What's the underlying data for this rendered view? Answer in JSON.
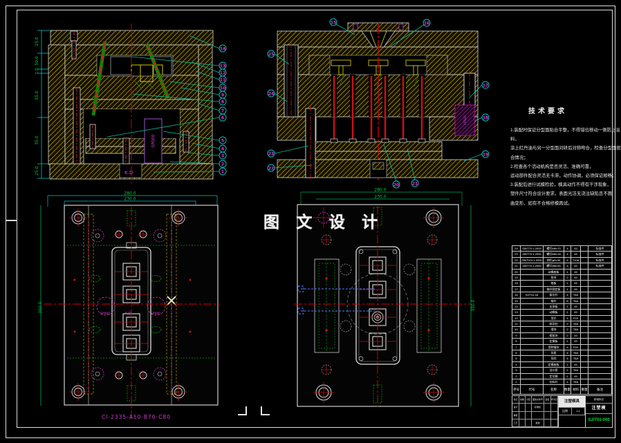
{
  "drawing": {
    "watermark": "图 文 设 计",
    "part_code": "CI-2335-A50-B70-C80"
  },
  "tech": {
    "title": "技术要求",
    "lines": [
      "1.装配时保证分型面贴合平整，不得错位移动一侧防止溢料，",
      "涂上红丹油与另一分型面对研后对称吻合，检查分型面密合情况；",
      "2.检查各个活动机构是否灵活、准确可靠，",
      "运动部件配合灵活无卡滞，动作协调，必须保证顺畅；",
      "3.装配后进行试模检验，模具动作不得有干涉现象，",
      "塑件尺寸符合设计要求，表面光洁无浇注缺陷且不翘",
      "曲变形、如有不合格修模再试。"
    ]
  },
  "views": {
    "section_left": {
      "dims": [
        "25.0",
        "50.0",
        "1.0",
        "55.0",
        "35.0",
        "25.0"
      ],
      "balloons": [
        "14",
        "13",
        "12",
        "11",
        "10",
        "9",
        "8",
        "7",
        "6",
        "5",
        "4",
        "3",
        "2",
        "1"
      ],
      "insert_label": "SP000",
      "gate_label": "K.D"
    },
    "section_right": {
      "balloons_top": [
        "15",
        "16"
      ],
      "balloons_left": [
        "25",
        "24",
        "23",
        "22"
      ],
      "balloons_right": [
        "17",
        "18",
        "19"
      ],
      "balloons_bottom": [
        "20",
        "21"
      ],
      "side_label": "SP000"
    },
    "plan_left": {
      "dim_outer": "280.0",
      "dim_inner": "230.0",
      "dim_height": "350.0",
      "sp_left": "SP000",
      "center_label": "K.D",
      "sp_right": "SP000"
    },
    "plan_right": {
      "dim_outer": "280.0",
      "dim_inner": "230.0",
      "dim_height": "350.0"
    }
  },
  "bom": {
    "headers": {
      "n": "序号",
      "code": "代号",
      "name": "名称",
      "qty": "数量",
      "mat": "材料",
      "wt": "重量",
      "rem": "备注"
    },
    "rows": [
      {
        "n": "24",
        "code": "GB/T70.1-2000",
        "name": "螺钉M8×70",
        "qty": "4",
        "mat": "45",
        "wt": "",
        "rem": "标准件"
      },
      {
        "n": "23",
        "code": "GB/T70.1-2000",
        "name": "螺钉M6×16",
        "qty": "4",
        "mat": "45",
        "wt": "",
        "rem": "标准件"
      },
      {
        "n": "22",
        "code": "GB/T119.1-2000",
        "name": "销钉φ6×30",
        "qty": "4",
        "mat": "T10A",
        "wt": "",
        "rem": "标准件"
      },
      {
        "n": "21",
        "code": "GB/T70.1-2000",
        "name": "螺钉M8×90",
        "qty": "4",
        "mat": "45",
        "wt": "",
        "rem": "标准件"
      },
      {
        "n": "20",
        "code": "",
        "name": "动模座板",
        "qty": "1",
        "mat": "45",
        "wt": "",
        "rem": ""
      },
      {
        "n": "19",
        "code": "",
        "name": "垫块",
        "qty": "2",
        "mat": "45",
        "wt": "",
        "rem": ""
      },
      {
        "n": "18",
        "code": "",
        "name": "推板",
        "qty": "1",
        "mat": "45",
        "wt": "",
        "rem": ""
      },
      {
        "n": "17",
        "code": "",
        "name": "推杆固定板",
        "qty": "1",
        "mat": "45",
        "wt": "",
        "rem": ""
      },
      {
        "n": "16",
        "code": "SJ/T01-16",
        "name": "复位杆",
        "qty": "4",
        "mat": "T8A",
        "wt": "",
        "rem": ""
      },
      {
        "n": "15",
        "code": "",
        "name": "推杆",
        "qty": "8",
        "mat": "T8A",
        "wt": "",
        "rem": ""
      },
      {
        "n": "14",
        "code": "",
        "name": "支承板",
        "qty": "1",
        "mat": "45",
        "wt": "",
        "rem": ""
      },
      {
        "n": "13",
        "code": "",
        "name": "动模板",
        "qty": "1",
        "mat": "45",
        "wt": "",
        "rem": ""
      },
      {
        "n": "12",
        "code": "",
        "name": "型芯",
        "qty": "4",
        "mat": "P20",
        "wt": "",
        "rem": ""
      },
      {
        "n": "11",
        "code": "",
        "name": "斜导柱",
        "qty": "2",
        "mat": "T8A",
        "wt": "",
        "rem": ""
      },
      {
        "n": "10",
        "code": "",
        "name": "滑块",
        "qty": "2",
        "mat": "T8A",
        "wt": "",
        "rem": ""
      },
      {
        "n": "9",
        "code": "",
        "name": "楔紧块",
        "qty": "2",
        "mat": "45",
        "wt": "",
        "rem": ""
      },
      {
        "n": "8",
        "code": "",
        "name": "定模板",
        "qty": "1",
        "mat": "45",
        "wt": "",
        "rem": ""
      },
      {
        "n": "7",
        "code": "",
        "name": "型腔镶块",
        "qty": "4",
        "mat": "P20",
        "wt": "",
        "rem": ""
      },
      {
        "n": "6",
        "code": "",
        "name": "导套",
        "qty": "4",
        "mat": "T8A",
        "wt": "",
        "rem": ""
      },
      {
        "n": "5",
        "code": "",
        "name": "导柱",
        "qty": "4",
        "mat": "T8A",
        "wt": "",
        "rem": ""
      },
      {
        "n": "4",
        "code": "",
        "name": "定模座板",
        "qty": "1",
        "mat": "45",
        "wt": "",
        "rem": ""
      },
      {
        "n": "3",
        "code": "",
        "name": "浇口套",
        "qty": "1",
        "mat": "T8A",
        "wt": "",
        "rem": ""
      },
      {
        "n": "2",
        "code": "",
        "name": "定位圈",
        "qty": "1",
        "mat": "45",
        "wt": "",
        "rem": ""
      },
      {
        "n": "1",
        "code": "",
        "name": "拉料杆",
        "qty": "1",
        "mat": "T8A",
        "wt": "",
        "rem": ""
      }
    ]
  },
  "title_block": {
    "sign_row": [
      "标记",
      "处数",
      "分区",
      "更改文件号",
      "签名",
      "年月日"
    ],
    "row2": [
      "设计",
      "",
      "",
      "标准化",
      "",
      ""
    ],
    "row3": [
      "审核",
      "",
      "",
      "",
      "",
      ""
    ],
    "row4": [
      "工艺",
      "",
      "",
      "批准",
      "",
      ""
    ],
    "name_box": "注塑模具",
    "scale_label": "比例",
    "scale": "1:1",
    "stage_label": "阶段标记",
    "mold_label": "注塑模",
    "doc_number": "SJ/T01-000"
  }
}
